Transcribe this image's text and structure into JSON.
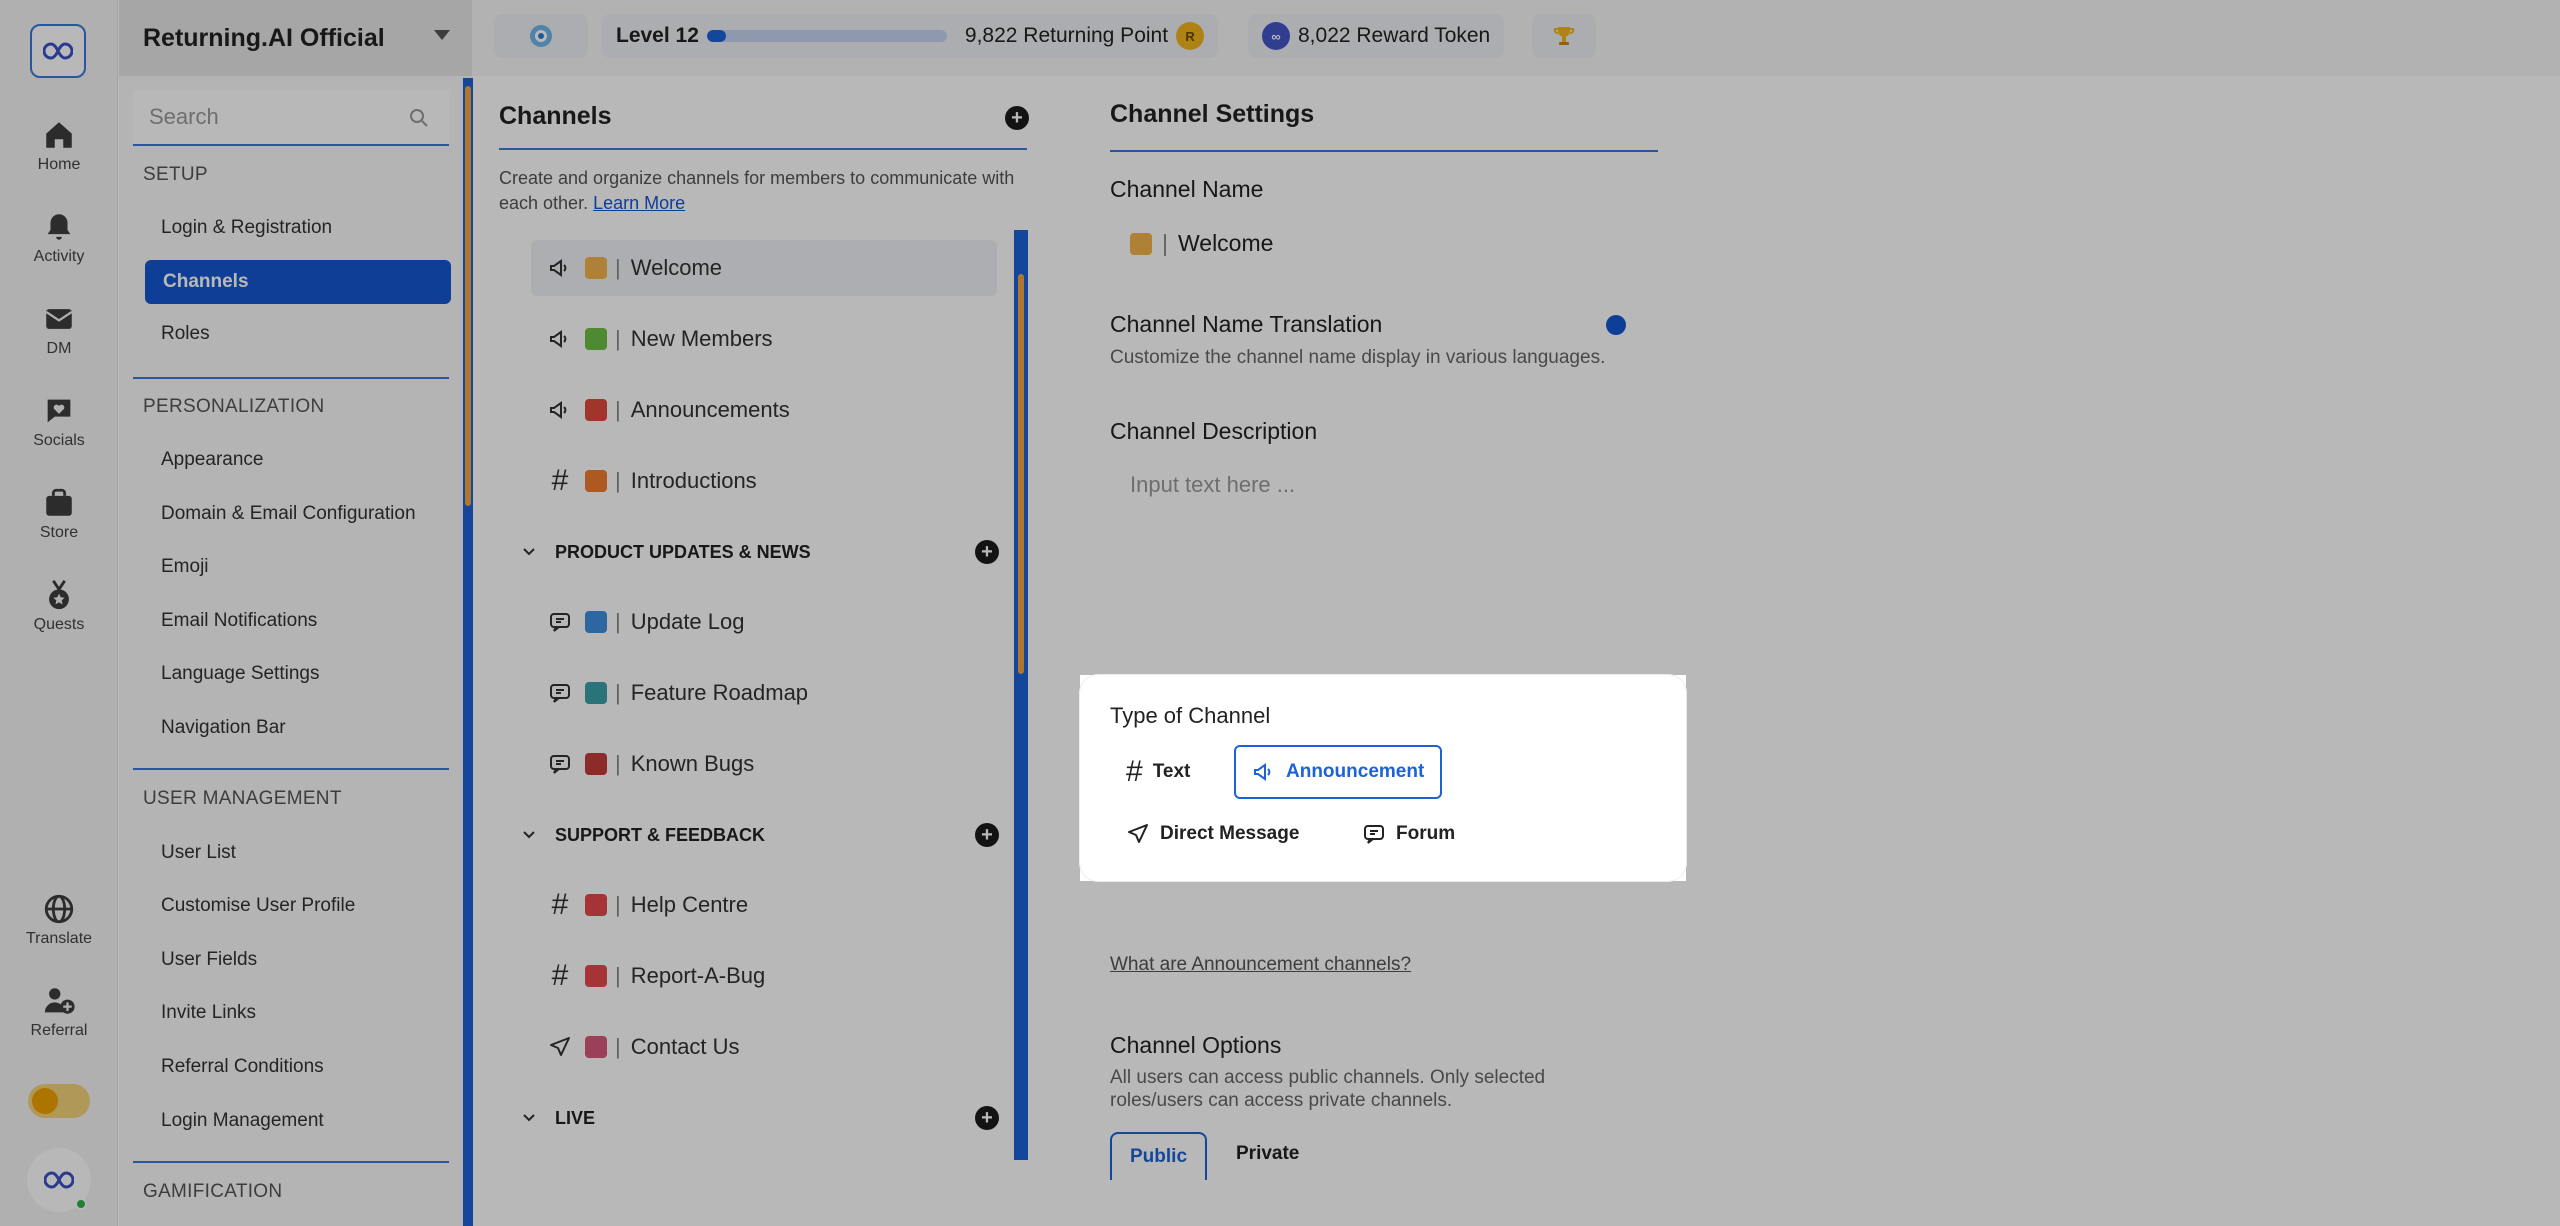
{
  "rail": {
    "items": [
      {
        "label": "Home",
        "icon": "home-icon"
      },
      {
        "label": "Activity",
        "icon": "bell-icon"
      },
      {
        "label": "DM",
        "icon": "mail-icon"
      },
      {
        "label": "Socials",
        "icon": "heart-chat-icon"
      },
      {
        "label": "Store",
        "icon": "bag-icon"
      },
      {
        "label": "Quests",
        "icon": "medal-icon"
      },
      {
        "label": "Translate",
        "icon": "globe-icon"
      },
      {
        "label": "Referral",
        "icon": "users-plus-icon"
      }
    ]
  },
  "sidebar": {
    "workspace": "Returning.AI Official",
    "search_placeholder": "Search",
    "sections": [
      {
        "title": "SETUP",
        "items": [
          "Login & Registration",
          "Channels",
          "Roles"
        ]
      },
      {
        "title": "PERSONALIZATION",
        "items": [
          "Appearance",
          "Domain & Email Configuration",
          "Emoji",
          "Email Notifications",
          "Language Settings",
          "Navigation Bar"
        ]
      },
      {
        "title": "USER MANAGEMENT",
        "items": [
          "User List",
          "Customise User Profile",
          "User Fields",
          "Invite Links",
          "Referral Conditions",
          "Login Management"
        ]
      },
      {
        "title": "GAMIFICATION",
        "items": []
      }
    ],
    "active_item": "Channels"
  },
  "topbar": {
    "level": "Level 12",
    "level_progress_percent": 8,
    "points": "9,822 Returning Point",
    "tokens": "8,022 Reward Token"
  },
  "channels": {
    "title": "Channels",
    "description": "Create and organize channels for members to communicate with each other.",
    "learn_more": "Learn More",
    "rows": [
      {
        "kind": "channel",
        "type": "announcement",
        "emoji_color": "#f1b34c",
        "name": "Welcome",
        "active": true
      },
      {
        "kind": "channel",
        "type": "announcement",
        "emoji_color": "#6bbf45",
        "name": "New Members"
      },
      {
        "kind": "channel",
        "type": "announcement",
        "emoji_color": "#e0483c",
        "name": "Announcements"
      },
      {
        "kind": "channel",
        "type": "text",
        "emoji_color": "#f07c2e",
        "name": "Introductions"
      },
      {
        "kind": "category",
        "name": "PRODUCT UPDATES & NEWS"
      },
      {
        "kind": "channel",
        "type": "forum",
        "emoji_color": "#3d8fe0",
        "name": "Update Log"
      },
      {
        "kind": "channel",
        "type": "forum",
        "emoji_color": "#3aa0a8",
        "name": "Feature Roadmap"
      },
      {
        "kind": "channel",
        "type": "forum",
        "emoji_color": "#c43b3b",
        "name": "Known Bugs"
      },
      {
        "kind": "category",
        "name": "SUPPORT & FEEDBACK"
      },
      {
        "kind": "channel",
        "type": "text",
        "emoji_color": "#e5484d",
        "name": "Help Centre"
      },
      {
        "kind": "channel",
        "type": "text",
        "emoji_color": "#e5484d",
        "name": "Report-A-Bug"
      },
      {
        "kind": "channel",
        "type": "dm",
        "emoji_color": "#d9587a",
        "name": "Contact Us"
      },
      {
        "kind": "category",
        "name": "LIVE"
      }
    ]
  },
  "settings": {
    "title": "Channel Settings",
    "name_label": "Channel Name",
    "name_value": "Welcome",
    "translation_label": "Channel Name Translation",
    "translation_hint": "Customize the channel name display in various languages.",
    "description_label": "Channel Description",
    "description_placeholder": "Input text here ...",
    "type_label": "Type of Channel",
    "types": [
      "Text",
      "Announcement",
      "Direct Message",
      "Forum"
    ],
    "selected_type": "Announcement",
    "what_link": "What are Announcement channels?",
    "options_label": "Channel Options",
    "options_hint": "All users can access public channels. Only selected roles/users can access private channels.",
    "visibility": [
      "Public",
      "Private"
    ],
    "selected_visibility": "Public"
  }
}
